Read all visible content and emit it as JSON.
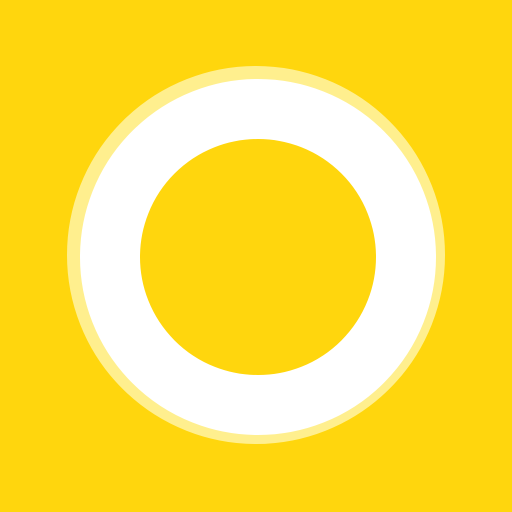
{
  "icon": {
    "name": "ring-icon",
    "colors": {
      "background": "#FFD60D",
      "ring": "#FFFFFF",
      "ring_glow": "#FFF3A6"
    }
  }
}
